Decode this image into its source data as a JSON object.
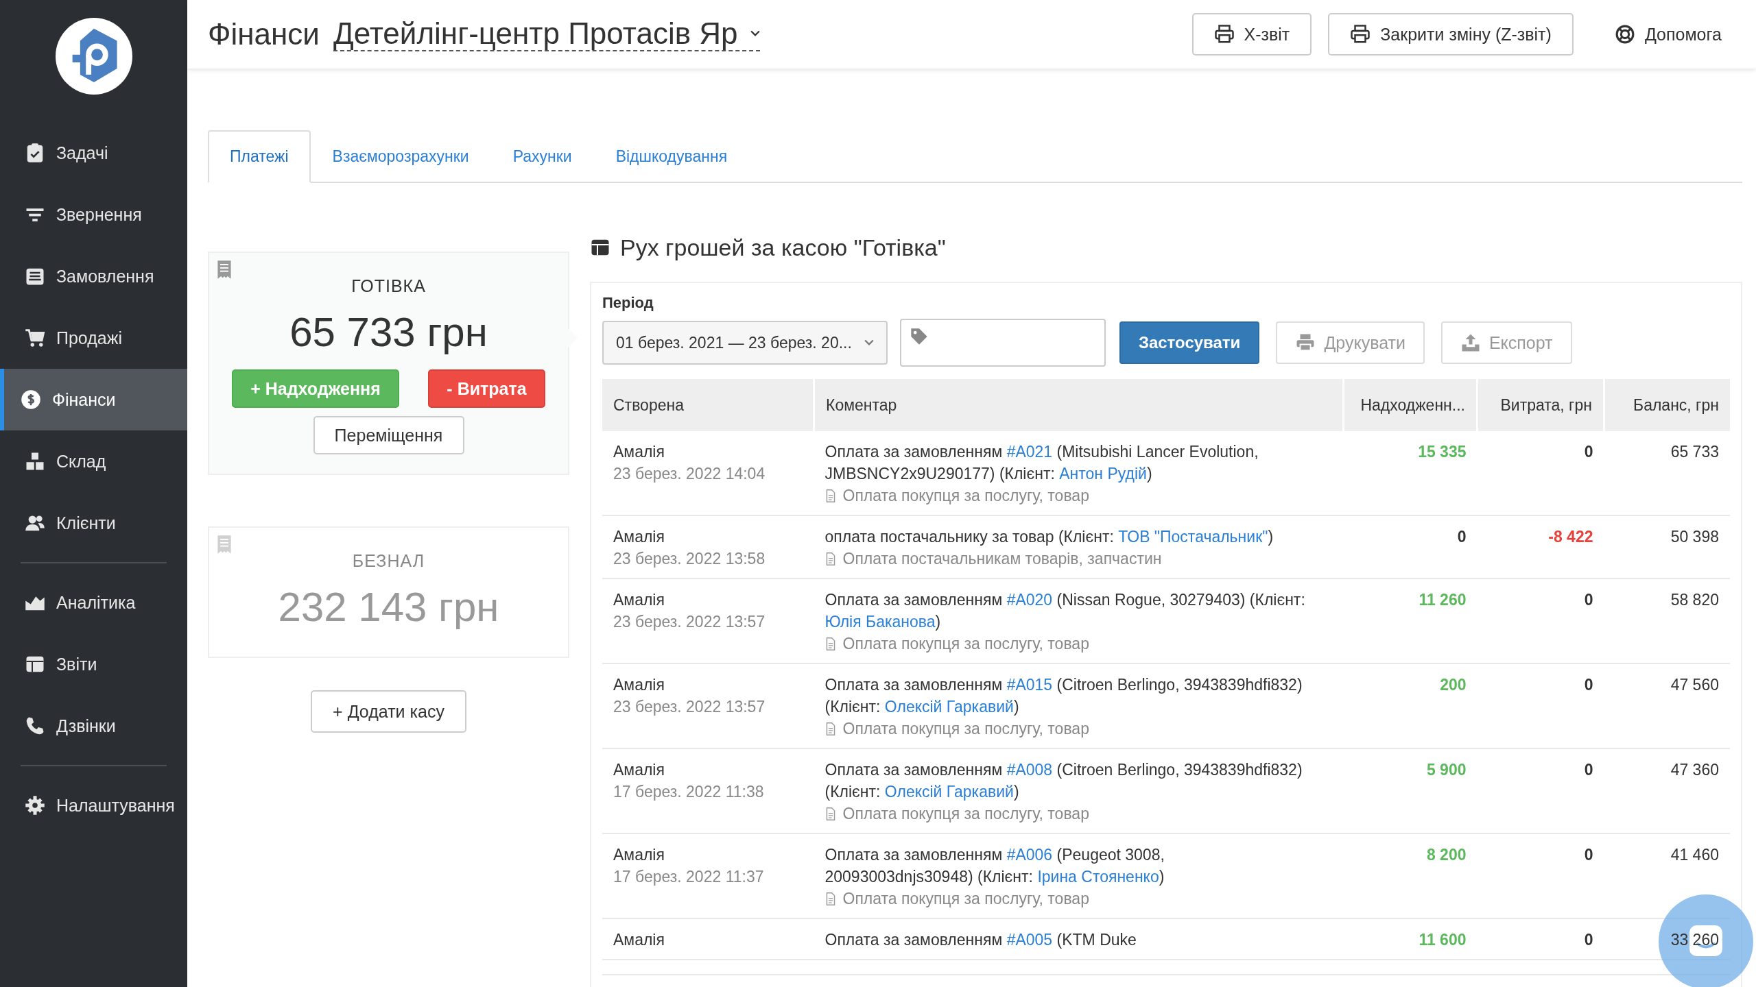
{
  "sidebar": {
    "groups": [
      {
        "items": [
          {
            "label": "Задачі",
            "selected": false
          },
          {
            "label": "Звернення",
            "selected": false
          },
          {
            "label": "Замовлення",
            "selected": false
          },
          {
            "label": "Продажі",
            "selected": false
          },
          {
            "label": "Фінанси",
            "selected": true
          },
          {
            "label": "Склад",
            "selected": false
          },
          {
            "label": "Клієнти",
            "selected": false
          }
        ]
      },
      {
        "items": [
          {
            "label": "Аналітика",
            "selected": false
          },
          {
            "label": "Звіти",
            "selected": false
          },
          {
            "label": "Дзвінки",
            "selected": false
          }
        ]
      },
      {
        "items": [
          {
            "label": "Налаштування",
            "selected": false
          }
        ]
      }
    ]
  },
  "header": {
    "title": "Фінанси",
    "location": "Детейлінг-центр Протасів Яр",
    "buttons": [
      "X-звіт",
      "Закрити зміну (Z-звіт)"
    ],
    "help": "Допомога"
  },
  "tabs": [
    {
      "label": "Платежі",
      "selected": true
    },
    {
      "label": "Взаєморозрахунки",
      "selected": false
    },
    {
      "label": "Рахунки",
      "selected": false
    },
    {
      "label": "Відшкодування",
      "selected": false
    }
  ],
  "cashboxes": [
    {
      "name": "ГОТІВКА",
      "amount": "65 733 грн",
      "selected": true,
      "actions": [
        {
          "label": "+ Надходження",
          "kind": "income"
        },
        {
          "label": "- Витрата",
          "kind": "expense"
        },
        {
          "label": "Переміщення",
          "kind": "transfer"
        }
      ]
    },
    {
      "name": "БЕЗНАЛ",
      "amount": "232 143 грн",
      "selected": false
    }
  ],
  "add_cashbox": "+ Додати касу",
  "movement": {
    "title": "Рух грошей за касою \"Готівка\"",
    "filter": {
      "period_label": "Період",
      "period_value": "01 берез. 2021 — 23 берез. 20...",
      "apply": "Застосувати",
      "print": {
        "label": "Друкувати",
        "disabled": true
      },
      "export": {
        "label": "Експорт",
        "disabled": true
      }
    },
    "table": {
      "columns": [
        "Створена",
        "Коментар",
        "Надходженн...",
        "Витрата, грн",
        "Баланс, грн"
      ],
      "rows": [
        {
          "author": "Амалія",
          "date": "23 берез. 2022 14:04",
          "comment": [
            {
              "text": "Оплата за замовленням "
            },
            {
              "link": "#A021"
            },
            {
              "text": " (Mitsubishi Lancer Evolution, JMBSNCY2x9U290177) (Клієнт: "
            },
            {
              "link": "Антон Рудій"
            },
            {
              "text": ")"
            }
          ],
          "category": "Оплата покупця за послугу, товар",
          "income": {
            "text": "15 335",
            "highlighted": true
          },
          "expense": {
            "text": "0",
            "highlighted": false
          },
          "balance": "65 733"
        },
        {
          "author": "Амалія",
          "date": "23 берез. 2022 13:58",
          "comment": [
            {
              "text": "оплата постачальнику за товар (Клієнт: "
            },
            {
              "link": "ТОВ \"Постачальник\""
            },
            {
              "text": ")"
            }
          ],
          "category": "Оплата постачальникам товарів, запчастин",
          "income": {
            "text": "0",
            "highlighted": false
          },
          "expense": {
            "text": "-8 422",
            "highlighted": true
          },
          "balance": "50 398"
        },
        {
          "author": "Амалія",
          "date": "23 берез. 2022 13:57",
          "comment": [
            {
              "text": "Оплата за замовленням "
            },
            {
              "link": "#A020"
            },
            {
              "text": " (Nissan Rogue, 30279403) (Клієнт: "
            },
            {
              "link": "Юлія Баканова"
            },
            {
              "text": ")"
            }
          ],
          "category": "Оплата покупця за послугу, товар",
          "income": {
            "text": "11 260",
            "highlighted": true
          },
          "expense": {
            "text": "0",
            "highlighted": false
          },
          "balance": "58 820"
        },
        {
          "author": "Амалія",
          "date": "23 берез. 2022 13:57",
          "comment": [
            {
              "text": "Оплата за замовленням "
            },
            {
              "link": "#A015"
            },
            {
              "text": " (Citroen Berlingo, 3943839hdfi832) (Клієнт: "
            },
            {
              "link": "Олексій Гаркавий"
            },
            {
              "text": ")"
            }
          ],
          "category": "Оплата покупця за послугу, товар",
          "income": {
            "text": "200",
            "highlighted": true
          },
          "expense": {
            "text": "0",
            "highlighted": false
          },
          "balance": "47 560"
        },
        {
          "author": "Амалія",
          "date": "17 берез. 2022 11:38",
          "comment": [
            {
              "text": "Оплата за замовленням "
            },
            {
              "link": "#A008"
            },
            {
              "text": " (Citroen Berlingo, 3943839hdfi832) (Клієнт: "
            },
            {
              "link": "Олексій Гаркавий"
            },
            {
              "text": ")"
            }
          ],
          "category": "Оплата покупця за послугу, товар",
          "income": {
            "text": "5 900",
            "highlighted": true
          },
          "expense": {
            "text": "0",
            "highlighted": false
          },
          "balance": "47 360"
        },
        {
          "author": "Амалія",
          "date": "17 берез. 2022 11:37",
          "comment": [
            {
              "text": "Оплата за замовленням "
            },
            {
              "link": "#A006"
            },
            {
              "text": " (Peugeot 3008, 20093003dnjs30948) (Клієнт: "
            },
            {
              "link": "Ірина Стояненко"
            },
            {
              "text": ")"
            }
          ],
          "category": "Оплата покупця за послугу, товар",
          "income": {
            "text": "8 200",
            "highlighted": true
          },
          "expense": {
            "text": "0",
            "highlighted": false
          },
          "balance": "41 460"
        },
        {
          "author": "Амалія",
          "comment": [
            {
              "text": "Оплата за замовленням "
            },
            {
              "link": "#A005"
            },
            {
              "text": " (KTM Duke"
            }
          ],
          "income": {
            "text": "11 600",
            "highlighted": true
          },
          "expense": {
            "text": "0",
            "highlighted": false
          },
          "balance": "33 260"
        }
      ]
    }
  }
}
